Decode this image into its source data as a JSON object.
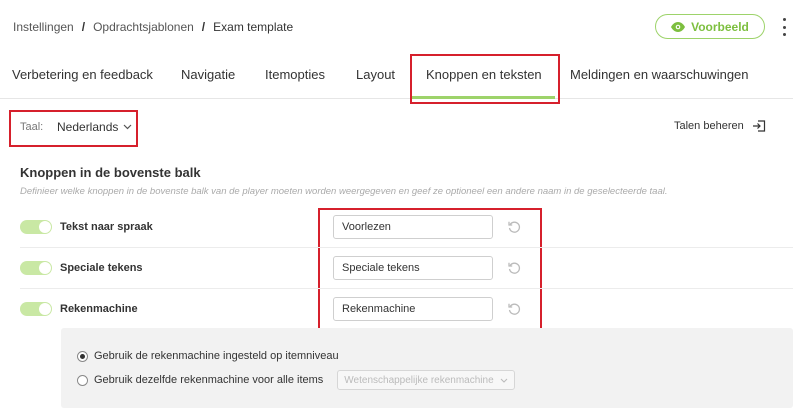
{
  "breadcrumb": {
    "items": [
      "Instellingen",
      "Opdrachtsjablonen",
      "Exam template"
    ],
    "separator": "/"
  },
  "header": {
    "preview_label": "Voorbeeld",
    "preview_icon": "eye-icon",
    "more_icon": "kebab-menu-icon"
  },
  "tabs": [
    {
      "label": "Verbetering en feedback"
    },
    {
      "label": "Navigatie"
    },
    {
      "label": "Itemopties"
    },
    {
      "label": "Layout"
    },
    {
      "label": "Knoppen en teksten",
      "active": true
    },
    {
      "label": "Meldingen en waarschuwingen"
    }
  ],
  "language": {
    "label": "Taal:",
    "value": "Nederlands",
    "manage_label": "Talen beheren"
  },
  "section": {
    "title": "Knoppen in de bovenste balk",
    "description": "Definieer welke knoppen in de bovenste balk van de player moeten worden weergegeven en geef ze optioneel een andere naam in de geselecteerde taal."
  },
  "buttons": [
    {
      "label": "Tekst naar spraak",
      "enabled": true,
      "value": "Voorlezen"
    },
    {
      "label": "Speciale tekens",
      "enabled": true,
      "value": "Speciale tekens"
    },
    {
      "label": "Rekenmachine",
      "enabled": true,
      "value": "Rekenmachine"
    }
  ],
  "calculator": {
    "option_item_level": "Gebruik de rekenmachine ingesteld op itemniveau",
    "option_all_items": "Gebruik dezelfde rekenmachine voor alle items",
    "selected_option": "item_level",
    "select_value": "Wetenschappelijke rekenmachine"
  },
  "colors": {
    "accent": "#7dbf3f",
    "accent_light": "#c9e8a4",
    "highlight": "#d6202c"
  }
}
